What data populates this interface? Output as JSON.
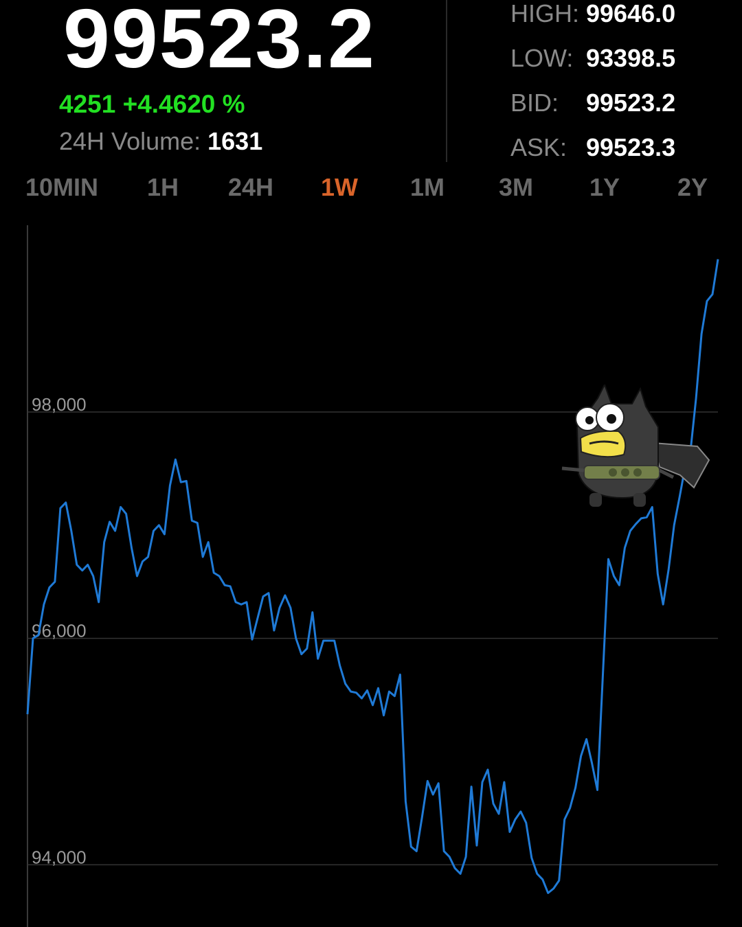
{
  "ticker": {
    "last_price": "99523.2",
    "change_abs": "4251",
    "change_pct": "+4.4620 %",
    "volume_label": "24H Volume:",
    "volume_value": "1631"
  },
  "stats": [
    {
      "key": "high",
      "label": "HIGH:",
      "value": "99646.0"
    },
    {
      "key": "low",
      "label": "LOW:",
      "value": "93398.5"
    },
    {
      "key": "bid",
      "label": "BID:",
      "value": "99523.2"
    },
    {
      "key": "ask",
      "label": "ASK:",
      "value": "99523.3"
    }
  ],
  "tabs": [
    "10MIN",
    "1H",
    "24H",
    "1W",
    "1M",
    "3M",
    "1Y",
    "2Y"
  ],
  "active_tab": "1W",
  "colors": {
    "background": "#000000",
    "positive": "#22e022",
    "active_tab": "#d9642a",
    "line": "#1f7ad6",
    "grid": "#333333"
  },
  "sticker_icon": "bat-costume-cartoon-icon",
  "chart_data": {
    "type": "line",
    "title": "",
    "xlabel": "",
    "ylabel": "",
    "ylim": [
      93450,
      99650
    ],
    "y_ticks": [
      94000,
      96000,
      98000
    ],
    "y_tick_labels": [
      "94,000",
      "96,000",
      "98,000"
    ],
    "grid": true,
    "series": [
      {
        "values": [
          95330,
          96000,
          96030,
          96300,
          96450,
          96500,
          97150,
          97200,
          96950,
          96650,
          96600,
          96650,
          96550,
          96320,
          96850,
          97030,
          96950,
          97160,
          97100,
          96800,
          96550,
          96680,
          96720,
          96950,
          97000,
          96920,
          97350,
          97580,
          97380,
          97390,
          97040,
          97020,
          96720,
          96850,
          96580,
          96550,
          96470,
          96460,
          96320,
          96300,
          96320,
          95990,
          96180,
          96370,
          96400,
          96070,
          96270,
          96380,
          96270,
          96000,
          95860,
          95910,
          96230,
          95820,
          95980,
          95980,
          95980,
          95760,
          95600,
          95530,
          95520,
          95470,
          95540,
          95410,
          95560,
          95320,
          95530,
          95490,
          95680,
          94560,
          94160,
          94120,
          94420,
          94740,
          94620,
          94720,
          94120,
          94070,
          93970,
          93920,
          94070,
          94690,
          94170,
          94730,
          94840,
          94540,
          94450,
          94730,
          94290,
          94400,
          94470,
          94370,
          94060,
          93920,
          93870,
          93750,
          93790,
          93860,
          94400,
          94500,
          94680,
          94960,
          95110,
          94900,
          94660,
          95680,
          96700,
          96550,
          96470,
          96800,
          96950,
          97010,
          97060,
          97070,
          97160,
          96570,
          96300,
          96610,
          97000,
          97250,
          97510,
          97660,
          98120,
          98690,
          98980,
          99040,
          99350
        ]
      }
    ]
  }
}
